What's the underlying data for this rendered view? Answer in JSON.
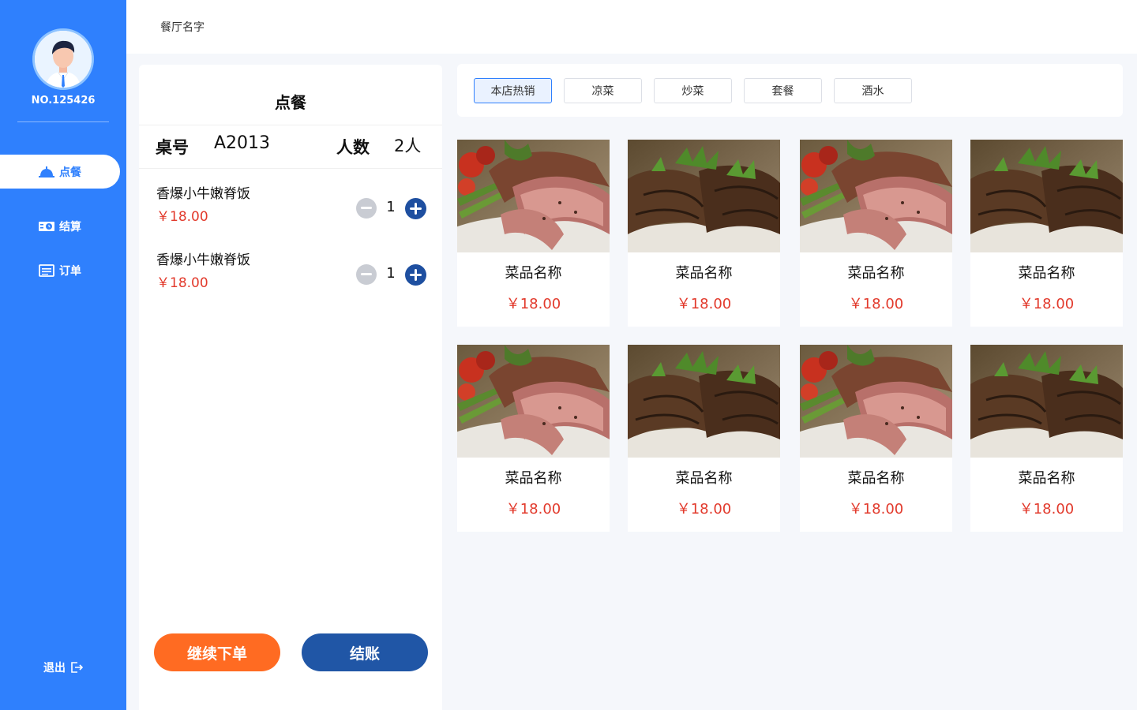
{
  "sidebar": {
    "user_no": "NO.125426",
    "nav": [
      {
        "label": "点餐",
        "icon": "bell-icon",
        "active": true
      },
      {
        "label": "结算",
        "icon": "money-icon",
        "active": false
      },
      {
        "label": "订单",
        "icon": "receipt-icon",
        "active": false
      }
    ],
    "logout_label": "退出"
  },
  "header": {
    "restaurant_name": "餐厅名字"
  },
  "order": {
    "title": "点餐",
    "table_label": "桌号",
    "table_value": "A2013",
    "people_label": "人数",
    "people_value": "2人",
    "items": [
      {
        "name": "香爆小牛嫩脊饭",
        "price": "￥18.00",
        "qty": "1"
      },
      {
        "name": "香爆小牛嫩脊饭",
        "price": "￥18.00",
        "qty": "1"
      }
    ],
    "continue_label": "继续下单",
    "checkout_label": "结账"
  },
  "categories": [
    {
      "label": "本店热销",
      "active": true
    },
    {
      "label": "凉菜",
      "active": false
    },
    {
      "label": "炒菜",
      "active": false
    },
    {
      "label": "套餐",
      "active": false
    },
    {
      "label": "酒水",
      "active": false
    }
  ],
  "dishes": [
    {
      "name": "菜品名称",
      "price": "￥18.00",
      "image": "steak-slices-photo"
    },
    {
      "name": "菜品名称",
      "price": "￥18.00",
      "image": "grilled-steak-photo"
    },
    {
      "name": "菜品名称",
      "price": "￥18.00",
      "image": "steak-slices-photo"
    },
    {
      "name": "菜品名称",
      "price": "￥18.00",
      "image": "grilled-steak-photo"
    },
    {
      "name": "菜品名称",
      "price": "￥18.00",
      "image": "steak-slices-photo"
    },
    {
      "name": "菜品名称",
      "price": "￥18.00",
      "image": "grilled-steak-photo"
    },
    {
      "name": "菜品名称",
      "price": "￥18.00",
      "image": "steak-slices-photo"
    },
    {
      "name": "菜品名称",
      "price": "￥18.00",
      "image": "grilled-steak-photo"
    }
  ],
  "colors": {
    "sidebar": "#2f80fd",
    "price": "#e23a2c",
    "continue_button": "#ff6b22",
    "checkout_button": "#2056a6"
  }
}
